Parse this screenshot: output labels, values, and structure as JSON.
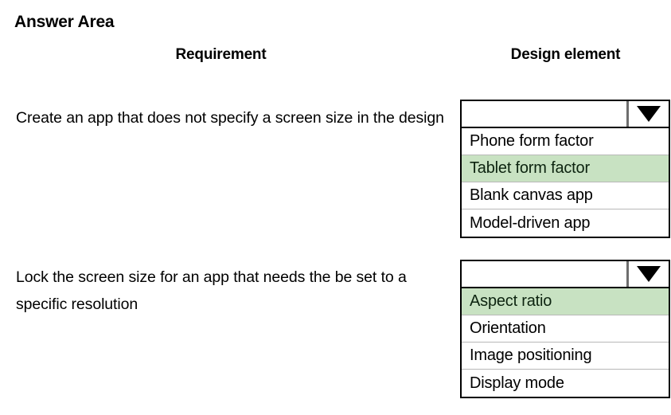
{
  "page": {
    "title": "Answer Area"
  },
  "columns": {
    "requirement_header": "Requirement",
    "design_header": "Design element"
  },
  "colors": {
    "highlight_green": "#c8e2c2",
    "highlight_text": "#0d2410",
    "border_black": "#000000",
    "separator_gray": "#b8b8b8",
    "divider_gray": "#6e6e6e"
  },
  "rows": [
    {
      "requirement": "Create an app that does not specify a screen size in the design",
      "dropdown": {
        "selected_value": "",
        "placeholder": "",
        "arrow_icon": "chevron-down-icon",
        "expanded": true,
        "options": [
          {
            "label": "Phone form factor",
            "selected": false
          },
          {
            "label": "Tablet form factor",
            "selected": true
          },
          {
            "label": "Blank canvas app",
            "selected": false
          },
          {
            "label": "Model-driven app",
            "selected": false
          }
        ]
      }
    },
    {
      "requirement": "Lock the screen size for an app that needs the be set to a specific resolution",
      "dropdown": {
        "selected_value": "",
        "placeholder": "",
        "arrow_icon": "chevron-down-icon",
        "expanded": true,
        "options": [
          {
            "label": "Aspect ratio",
            "selected": true
          },
          {
            "label": "Orientation",
            "selected": false
          },
          {
            "label": "Image positioning",
            "selected": false
          },
          {
            "label": "Display mode",
            "selected": false
          }
        ]
      }
    }
  ]
}
